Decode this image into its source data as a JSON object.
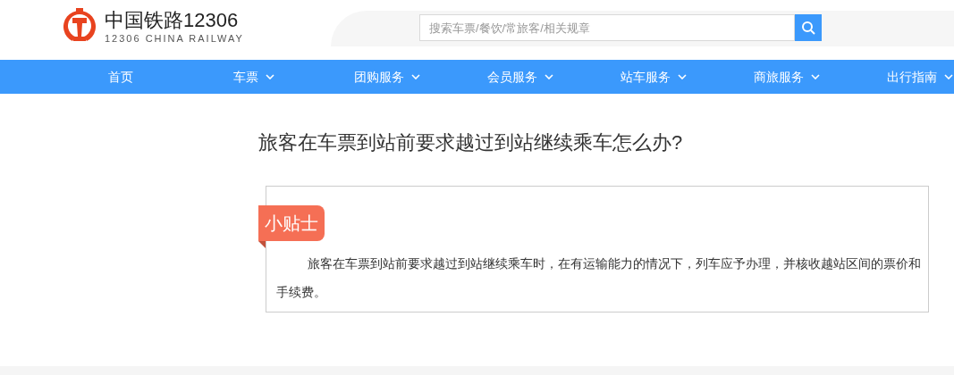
{
  "header": {
    "logo_title": "中国铁路12306",
    "logo_subtitle": "12306 CHINA RAILWAY",
    "search": {
      "placeholder": "搜索车票/餐饮/常旅客/相关规章"
    }
  },
  "nav": [
    {
      "label": "首页",
      "has_menu": false
    },
    {
      "label": "车票",
      "has_menu": true
    },
    {
      "label": "团购服务",
      "has_menu": true
    },
    {
      "label": "会员服务",
      "has_menu": true
    },
    {
      "label": "站车服务",
      "has_menu": true
    },
    {
      "label": "商旅服务",
      "has_menu": true
    },
    {
      "label": "出行指南",
      "has_menu": true
    }
  ],
  "article": {
    "title": "旅客在车票到站前要求越过到站继续乘车怎么办?",
    "tip_label": "小贴士",
    "body": "旅客在车票到站前要求越过到站继续乘车时，在有运输能力的情况下，列车应予办理，并核收越站区间的票价和手续费。"
  }
}
